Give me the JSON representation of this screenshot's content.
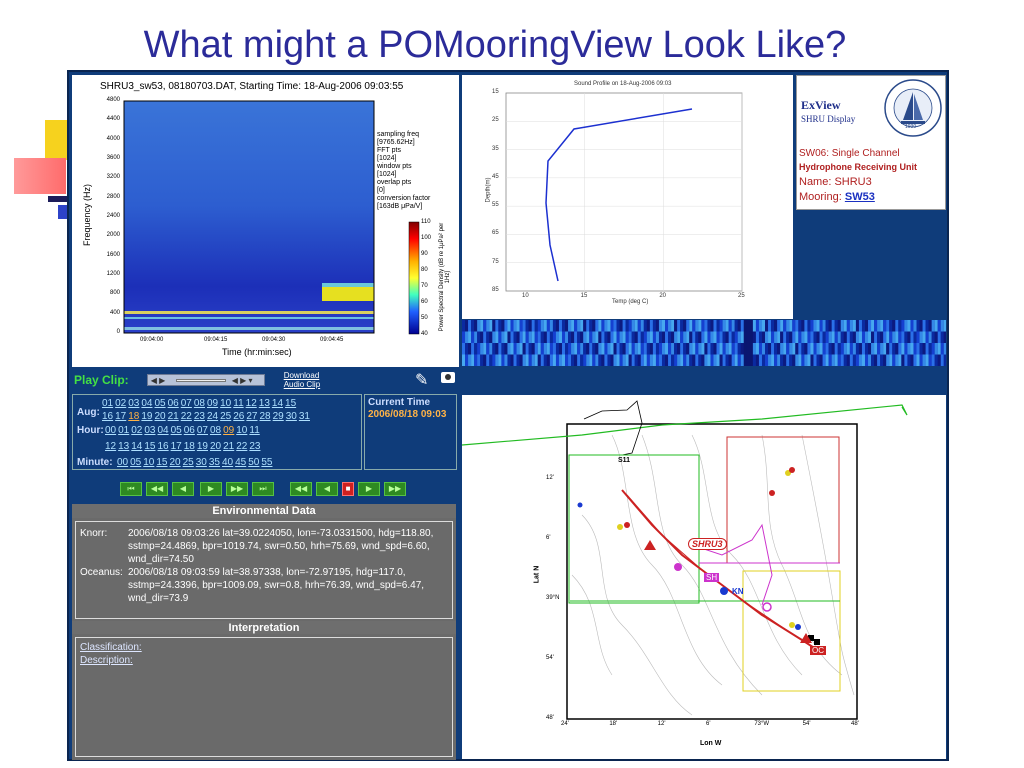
{
  "slide": {
    "title": "What might a POMooringView Look Like?"
  },
  "spectrogram": {
    "title": "SHRU3_sw53, 08180703.DAT, Starting Time: 18-Aug-2006 09:03:55",
    "ylabel": "Frequency (Hz)",
    "xlabel": "Time (hr:min:sec)",
    "y_ticks": [
      "4800",
      "4400",
      "4000",
      "3600",
      "3200",
      "2800",
      "2400",
      "2000",
      "1600",
      "1200",
      "800",
      "400",
      "0"
    ],
    "x_ticks": [
      "09:04:00",
      "09:04:15",
      "09:04:30",
      "09:04:45"
    ],
    "params": [
      "sampling freq",
      "[9765.62Hz]",
      "FFT pts",
      "[1024]",
      "window pts",
      "[1024]",
      "overlap pts",
      "[0]",
      "conversion factor",
      "[163dB μPa/V]"
    ],
    "colorbar_ticks": [
      "110",
      "100",
      "90",
      "80",
      "70",
      "60",
      "50",
      "40"
    ],
    "colorbar_label": "Power Spectral Density (dB re 1μPa² per 1Hz)"
  },
  "profile": {
    "title": "Sound Profile on 18-Aug-2006 09:03",
    "xlabel": "Temp (deg C)",
    "ylabel": "Depth(m)",
    "x_ticks": [
      "10",
      "15",
      "20",
      "25"
    ],
    "y_ticks": [
      "15",
      "25",
      "35",
      "45",
      "55",
      "65",
      "75",
      "85"
    ]
  },
  "exview": {
    "title": "ExView",
    "subtitle": "SHRU Display",
    "seal_text": "WOODS HOLE OCEANOGRAPHIC INSTITUTION",
    "seal_year": "1930",
    "line1": "SW06: Single Channel",
    "line2": "Hydrophone Receiving Unit",
    "name": "Name: SHRU3",
    "mooring_label": "Mooring: ",
    "mooring_link": "SW53"
  },
  "playclip": {
    "label": "Play Clip:",
    "download": "Download",
    "audio_clip": "Audio Clip"
  },
  "time_select": {
    "aug_label": "Aug:",
    "aug_row1": [
      "01",
      "02",
      "03",
      "04",
      "05",
      "06",
      "07",
      "08",
      "09",
      "10",
      "11",
      "12",
      "13",
      "14",
      "15"
    ],
    "aug_row2": [
      "16",
      "17",
      "18",
      "19",
      "20",
      "21",
      "22",
      "23",
      "24",
      "25",
      "26",
      "27",
      "28",
      "29",
      "30",
      "31"
    ],
    "hour_label": "Hour:",
    "hour_row1": [
      "00",
      "01",
      "02",
      "03",
      "04",
      "05",
      "06",
      "07",
      "08",
      "09",
      "10",
      "11"
    ],
    "hour_row2": [
      "12",
      "13",
      "14",
      "15",
      "16",
      "17",
      "18",
      "19",
      "20",
      "21",
      "22",
      "23"
    ],
    "minute_label": "Minute:",
    "minute_row": [
      "00",
      "05",
      "10",
      "15",
      "20",
      "25",
      "30",
      "35",
      "40",
      "45",
      "50",
      "55"
    ],
    "selected_day": "18",
    "selected_hour": "09"
  },
  "current_time": {
    "label": "Current Time",
    "value": "2006/08/18 09:03"
  },
  "environmental": {
    "header": "Environmental Data",
    "knorr_label": "Knorr:",
    "knorr_line1": "2006/08/18 09:03:26   lat=39.0224050, lon=-73.0331500, hdg=118.80,",
    "knorr_line2": "sstmp=24.4869, bpr=1019.74, swr=0.50, hrh=75.69, wnd_spd=6.60,",
    "knorr_line3": "wnd_dir=74.50",
    "oceanus_label": "Oceanus:",
    "oceanus_line1": "2006/08/18 09:03:59   lat=38.97338, lon=-72.97195, hdg=117.0,",
    "oceanus_line2": "sstmp=24.3396, bpr=1009.09, swr=0.8, hrh=76.39, wnd_spd=6.47,",
    "oceanus_line3": "wnd_dir=73.9"
  },
  "interpretation": {
    "header": "Interpretation",
    "classification": "Classification:",
    "description": "Description:"
  },
  "map": {
    "ylabel": "Lat N",
    "xlabel": "Lon W",
    "x_ticks": [
      "24'",
      "18'",
      "12'",
      "6'",
      "73°W",
      "54'",
      "48'"
    ],
    "y_ticks": [
      "12'",
      "6'",
      "39°N",
      "54'",
      "48'"
    ],
    "labels": {
      "shru": "SHRU3",
      "sh": "SH",
      "kn": "KN",
      "oc": "OC",
      "s11": "S11"
    }
  }
}
